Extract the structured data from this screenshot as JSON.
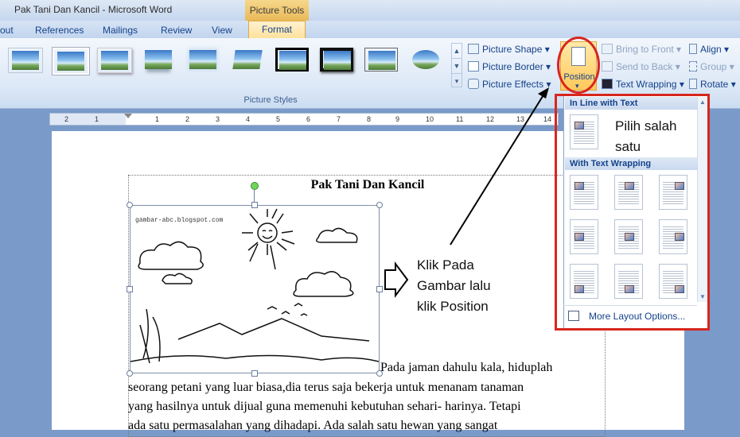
{
  "titlebar": {
    "title": "Pak Tani Dan Kancil - Microsoft Word",
    "context_tab": "Picture Tools"
  },
  "tabs": [
    {
      "label": "out"
    },
    {
      "label": "References"
    },
    {
      "label": "Mailings"
    },
    {
      "label": "Review"
    },
    {
      "label": "View"
    },
    {
      "label": "Format",
      "active": true
    }
  ],
  "ribbon": {
    "picture_styles_label": "Picture Styles",
    "picture_shape": "Picture Shape",
    "picture_border": "Picture Border",
    "picture_effects": "Picture Effects",
    "position": "Position",
    "bring_to_front": "Bring to Front",
    "send_to_back": "Send to Back",
    "text_wrapping": "Text Wrapping",
    "align": "Align",
    "group": "Group",
    "rotate": "Rotate"
  },
  "ruler": {
    "labels": [
      "2",
      "1",
      "1",
      "2",
      "3",
      "4",
      "5",
      "6",
      "7",
      "8",
      "9",
      "10",
      "11",
      "12",
      "13",
      "14"
    ]
  },
  "document": {
    "title": "Pak Tani Dan Kancil",
    "image_watermark": "gambar-abc.blogspot.com",
    "line1": "Pada jaman dahulu kala, hiduplah",
    "line2": "seorang petani yang luar biasa,dia terus saja bekerja untuk menanam tanaman",
    "line3": "yang hasilnya untuk dijual guna memenuhi kebutuhan sehari- harinya. Tetapi",
    "line4": "ada satu permasalahan yang dihadapi. Ada salah satu hewan yang sangat"
  },
  "annotations": {
    "instruction_lines": [
      "Klik Pada",
      "Gambar lalu",
      "klik Position"
    ],
    "choose_lines": [
      "Pilih salah",
      "satu"
    ]
  },
  "dropdown": {
    "inline_header": "In Line with Text",
    "wrapping_header": "With Text Wrapping",
    "more_layout_options": "More Layout Options..."
  },
  "colors": {
    "highlight_red": "#d7261f",
    "ribbon_blue": "#15428b",
    "active_tab": "#fde29c"
  }
}
